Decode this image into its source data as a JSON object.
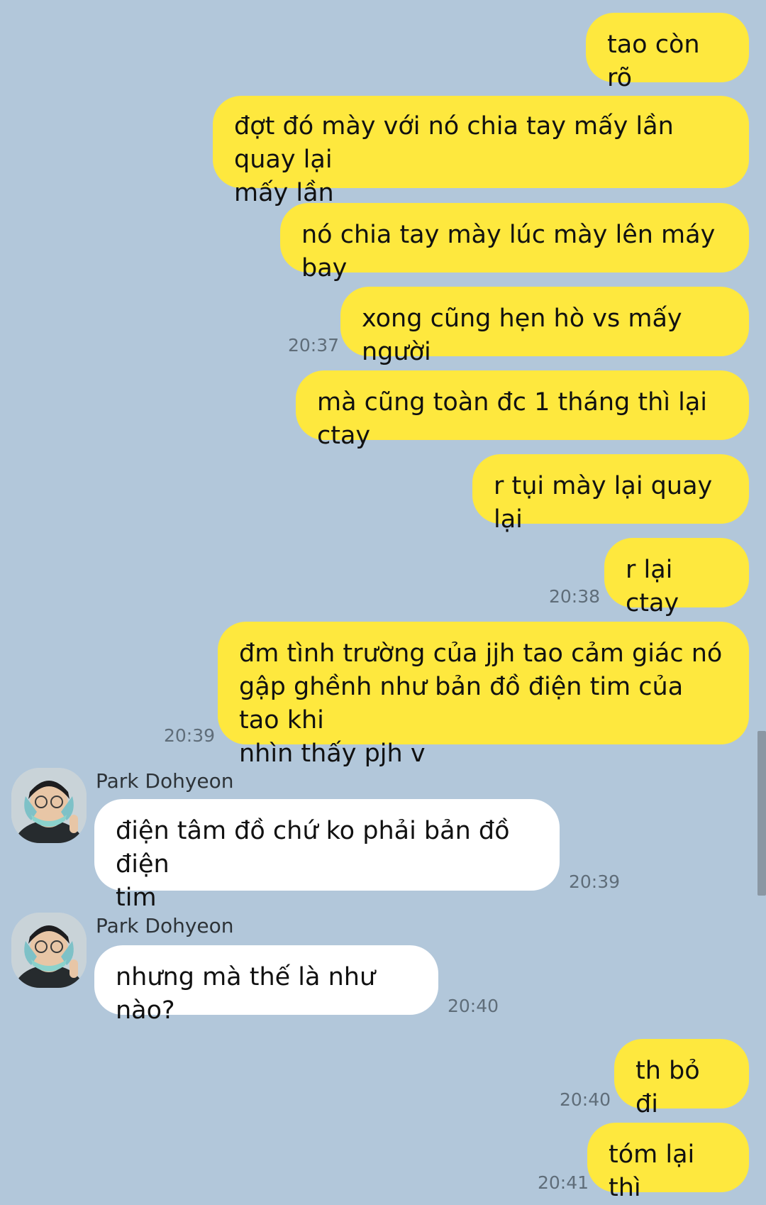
{
  "messages": [
    {
      "id": 1,
      "side": "out",
      "text": "tao còn rõ",
      "time": ""
    },
    {
      "id": 2,
      "side": "out",
      "text": "đợt đó mày với nó chia tay mấy lần quay lại\nmấy lần",
      "time": ""
    },
    {
      "id": 3,
      "side": "out",
      "text": "nó chia tay mày lúc mày lên máy bay",
      "time": ""
    },
    {
      "id": 4,
      "side": "out",
      "text": "xong cũng hẹn hò vs mấy người",
      "time": "20:37"
    },
    {
      "id": 5,
      "side": "out",
      "text": "mà cũng toàn đc 1 tháng thì lại ctay",
      "time": ""
    },
    {
      "id": 6,
      "side": "out",
      "text": "r tụi mày lại quay lại",
      "time": ""
    },
    {
      "id": 7,
      "side": "out",
      "text": "r lại ctay",
      "time": "20:38"
    },
    {
      "id": 8,
      "side": "out",
      "text": "đm tình trường của jjh tao cảm giác nó\ngập ghềnh như bản đồ điện tim của tao khi\nnhìn thấy pjh v",
      "time": "20:39"
    },
    {
      "id": 9,
      "side": "in",
      "sender": "Park Dohyeon",
      "text": "điện tâm đồ chứ ko phải bản đồ điện\ntim",
      "time": "20:39"
    },
    {
      "id": 10,
      "side": "in",
      "sender": "Park Dohyeon",
      "text": "nhưng mà thế là như nào?",
      "time": "20:40"
    },
    {
      "id": 11,
      "side": "out",
      "text": "th bỏ đi",
      "time": "20:40"
    },
    {
      "id": 12,
      "side": "out",
      "text": "tóm lại thì",
      "time": "20:41"
    }
  ],
  "colors": {
    "background": "#b2c7da",
    "outgoing_bubble": "#fee83e",
    "incoming_bubble": "#ffffff",
    "timestamp": "#5f6d79"
  },
  "icons": {
    "avatar": "user-avatar-photo"
  }
}
